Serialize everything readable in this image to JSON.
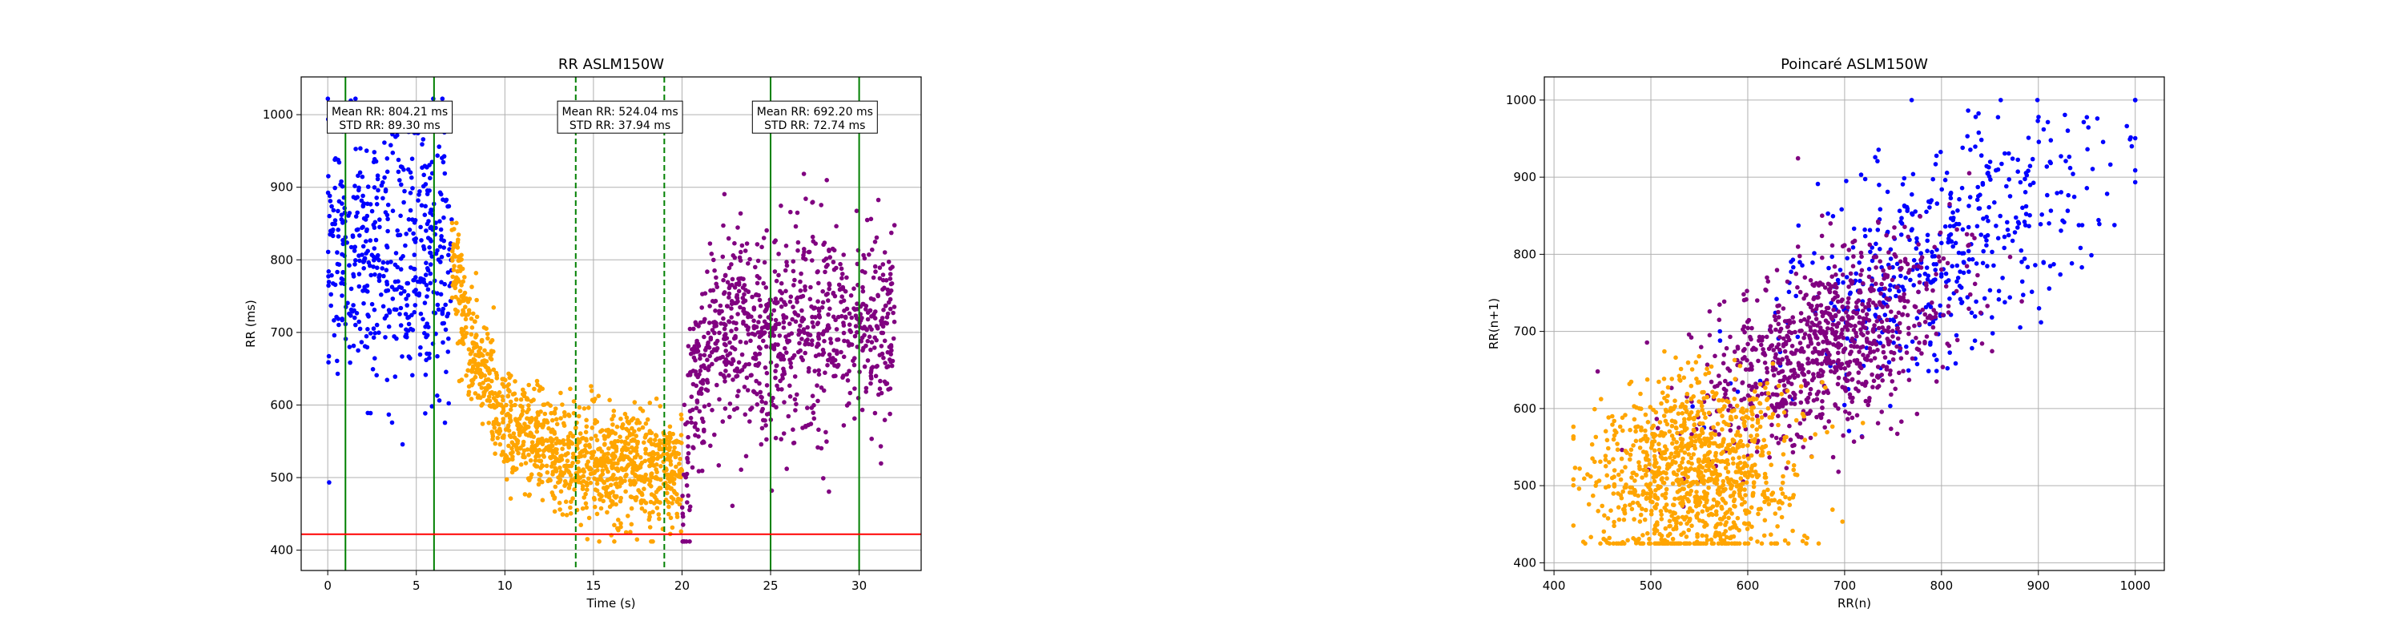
{
  "chart_data": [
    {
      "type": "scatter",
      "title": "RR ASLM150W",
      "xlabel": "Time (s)",
      "ylabel": "RR (ms)",
      "xlim": [
        -1.5,
        33.5
      ],
      "ylim": [
        372,
        1052
      ],
      "xticks": [
        0,
        5,
        10,
        15,
        20,
        25,
        30
      ],
      "yticks": [
        400,
        500,
        600,
        700,
        800,
        900,
        1000
      ],
      "grid": true,
      "series": [
        {
          "color": "#0000ff",
          "x_range": [
            0,
            7
          ],
          "mean": 804.21,
          "std": 89.3,
          "n": 520
        },
        {
          "color": "#ffa500",
          "x_range": [
            7,
            20
          ],
          "trend": [
            [
              7,
              820
            ],
            [
              8,
              680
            ],
            [
              9,
              640
            ],
            [
              10,
              570
            ],
            [
              12,
              540
            ],
            [
              14,
              525
            ],
            [
              16,
              520
            ],
            [
              18,
              512
            ],
            [
              20,
              505
            ]
          ],
          "std": 38,
          "n": 1200
        },
        {
          "color": "#800080",
          "x_range": [
            20,
            32
          ],
          "trend": [
            [
              20,
              470
            ],
            [
              20.6,
              620
            ],
            [
              22,
              700
            ],
            [
              26,
              690
            ],
            [
              29,
              720
            ],
            [
              32,
              700
            ]
          ],
          "std": 70,
          "n": 950
        }
      ],
      "vlines": [
        {
          "x": 1,
          "color": "#008000",
          "style": "solid"
        },
        {
          "x": 6,
          "color": "#008000",
          "style": "solid"
        },
        {
          "x": 14,
          "color": "#008000",
          "style": "dashed"
        },
        {
          "x": 19,
          "color": "#008000",
          "style": "dashed"
        },
        {
          "x": 25,
          "color": "#008000",
          "style": "solid"
        },
        {
          "x": 30,
          "color": "#008000",
          "style": "solid"
        }
      ],
      "hline": {
        "y": 422,
        "color": "#ff0000"
      },
      "annotations": [
        {
          "x": 3.5,
          "y": 990,
          "line1": "Mean RR: 804.21 ms",
          "line2": "STD RR: 89.30 ms"
        },
        {
          "x": 16.5,
          "y": 990,
          "line1": "Mean RR: 524.04 ms",
          "line2": "STD RR: 37.94 ms"
        },
        {
          "x": 27.5,
          "y": 990,
          "line1": "Mean RR: 692.20 ms",
          "line2": "STD RR: 72.74 ms"
        }
      ]
    },
    {
      "type": "scatter",
      "title": "Poincaré ASLM150W",
      "xlabel": "RR(n)",
      "ylabel": "RR(n+1)",
      "xlim": [
        390,
        1030
      ],
      "ylim": [
        390,
        1030
      ],
      "xticks": [
        400,
        500,
        600,
        700,
        800,
        900,
        1000
      ],
      "yticks": [
        400,
        500,
        600,
        700,
        800,
        900,
        1000
      ],
      "grid": true,
      "series": [
        {
          "color": "#0000ff",
          "center": [
            804,
            804
          ],
          "spread_major": 110,
          "spread_minor": 55,
          "n": 500
        },
        {
          "color": "#800080",
          "center": [
            680,
            680
          ],
          "spread_major": 80,
          "spread_minor": 45,
          "n": 900
        },
        {
          "color": "#ffa500",
          "center": [
            540,
            540
          ],
          "spread_major": 55,
          "spread_minor": 45,
          "n": 1100
        }
      ]
    }
  ]
}
